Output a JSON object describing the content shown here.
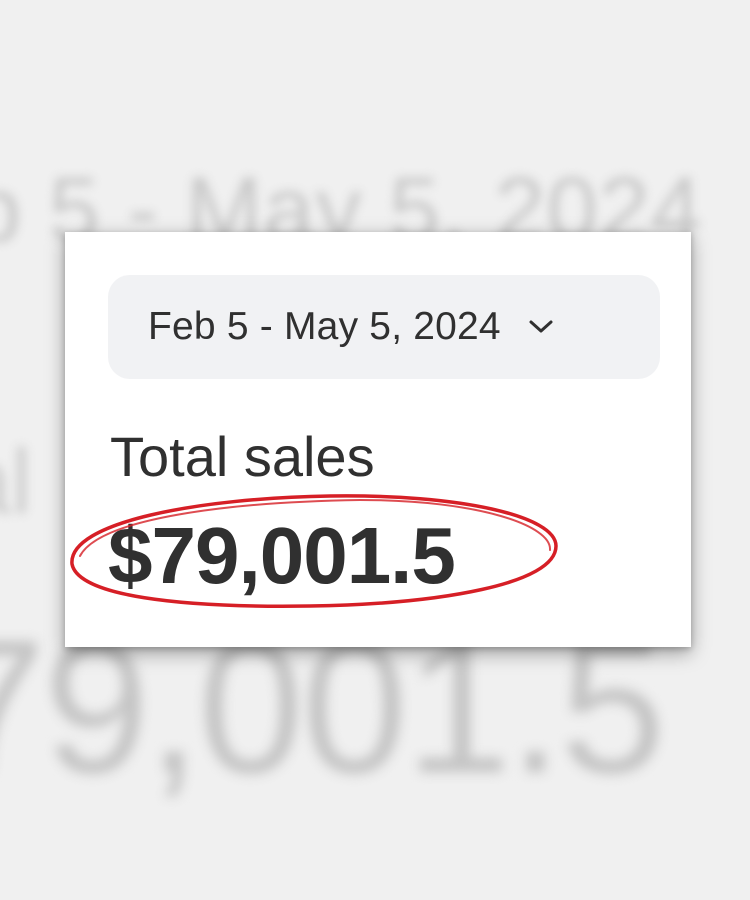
{
  "background": {
    "date_text": "b 5 - May 5, 2024",
    "label_text": "al",
    "amount_text": "79,001.5"
  },
  "card": {
    "date_range": {
      "label": "Feb 5 - May 5, 2024",
      "icon": "chevron-down-icon"
    },
    "metric": {
      "label": "Total sales",
      "value": "$79,001.5"
    }
  },
  "annotation": {
    "type": "red-ellipse",
    "color": "#d61f26"
  }
}
